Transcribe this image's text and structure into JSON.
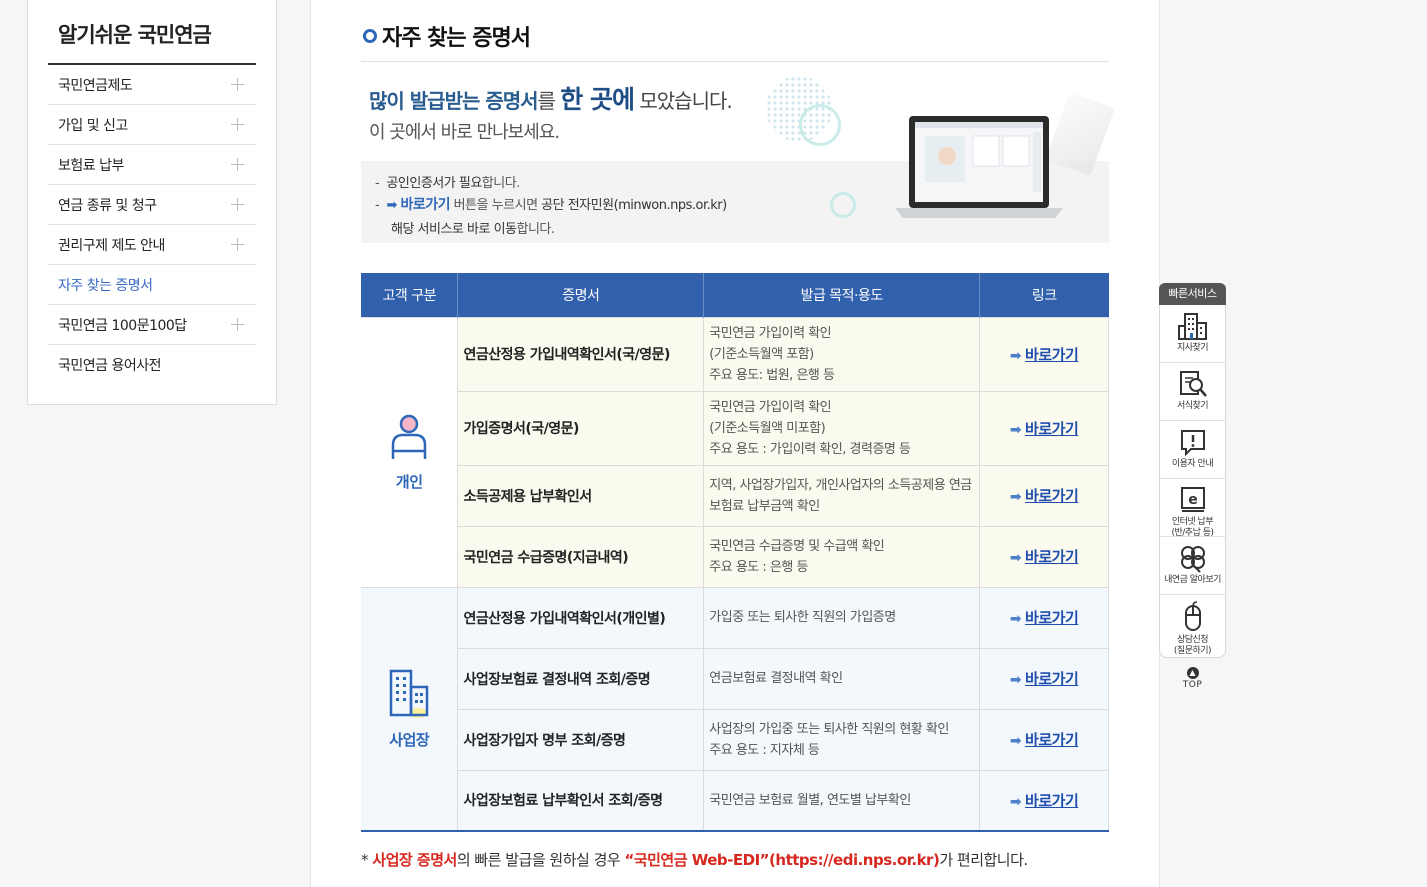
{
  "sidebar": {
    "title": "알기쉬운 국민연금",
    "items": [
      {
        "label": "국민연금제도"
      },
      {
        "label": "가입 및 신고"
      },
      {
        "label": "보험료 납부"
      },
      {
        "label": "연금 종류 및 청구"
      },
      {
        "label": "권리구제 제도 안내"
      },
      {
        "label": "자주 찾는 증명서"
      },
      {
        "label": "국민연금 100문100답"
      },
      {
        "label": "국민연금 용어사전"
      }
    ]
  },
  "page": {
    "title": "자주 찾는 증명서"
  },
  "banner": {
    "headline_part1": "많이 발급받는 증명서",
    "headline_part2": "를 ",
    "headline_part3": "한 곳에",
    "headline_part4": " 모았습니다.",
    "headline_line2": "이 곳에서 바로 만나보세요.",
    "note1_a": "공인인증서가 필요",
    "note1_b": "합니다.",
    "note2_link": "바로가기",
    "note2_a": " 버튼을 누르시면 ",
    "note2_b": "공단 전자민원(minwon.nps.or.kr)",
    "note3_a": "해당 서비스로 바로 이동",
    "note3_b": "합니다."
  },
  "table": {
    "headers": [
      "고객 구분",
      "증명서",
      "발급 목적·용도",
      "링크"
    ],
    "link_label": "바로가기",
    "groups": [
      {
        "label": "개인",
        "rows": [
          {
            "name": "연금산정용 가입내역확인서(국/영문)",
            "purpose": [
              "국민연금 가입이력 확인",
              "(기준소득월액 포함)",
              "주요 용도: 법원, 은행 등"
            ]
          },
          {
            "name": "가입증명서(국/영문)",
            "purpose": [
              "국민연금 가입이력 확인",
              "(기준소득월액 미포함)",
              "주요 용도 : 가입이력 확인, 경력증명 등"
            ]
          },
          {
            "name": "소득공제용 납부확인서",
            "purpose": [
              "지역, 사업장가입자, 개인사업자의 소득공제용 연금",
              "보험료 납부금액 확인"
            ]
          },
          {
            "name": "국민연금 수급증명(지급내역)",
            "purpose": [
              "국민연금 수급증명 및 수급액 확인",
              "주요 용도 : 은행 등"
            ]
          }
        ]
      },
      {
        "label": "사업장",
        "rows": [
          {
            "name": "연금산정용 가입내역확인서(개인별)",
            "purpose": [
              "가입중 또는 퇴사한 직원의 가입증명"
            ]
          },
          {
            "name": "사업장보험료 결정내역 조회/증명",
            "purpose": [
              "연금보험료 결정내역 확인"
            ]
          },
          {
            "name": "사업장가입자 명부 조회/증명",
            "purpose": [
              "사업장의 가입중 또는 퇴사한 직원의 현황 확인",
              "주요 용도 : 지자체 등"
            ]
          },
          {
            "name": "사업장보험료 납부확인서 조회/증명",
            "purpose": [
              "국민연금 보험료 월별, 연도별 납부확인"
            ]
          }
        ]
      }
    ]
  },
  "footnote": {
    "star": "* ",
    "red1": "사업장 증명서",
    "mid": "의 빠른 발급을 원하실 경우 ",
    "red2": "“국민연금 Web-EDI”(https://edi.nps.or.kr)",
    "end": "가 편리합니다."
  },
  "quick": {
    "title": "빠른서비스",
    "items": [
      {
        "label": "지사찾기",
        "icon": "building-icon"
      },
      {
        "label": "서식찾기",
        "icon": "document-search-icon"
      },
      {
        "label": "이용자 안내",
        "icon": "exclamation-bubble-icon"
      },
      {
        "label_line1": "인터넷 납부",
        "label_line2": "(반/추납 등)",
        "icon": "internet-pay-icon"
      },
      {
        "label": "내연금 알아보기",
        "icon": "clover-icon"
      },
      {
        "label_line1": "상담신청",
        "label_line2": "(질문하기)",
        "icon": "mouse-icon"
      }
    ],
    "top_label": "TOP"
  },
  "colors": {
    "primary": "#3161ad",
    "link": "#1f4eac",
    "accent_red": "#d6281f",
    "individual_bg": "#fbfaee",
    "business_bg": "#f2f8fc"
  }
}
